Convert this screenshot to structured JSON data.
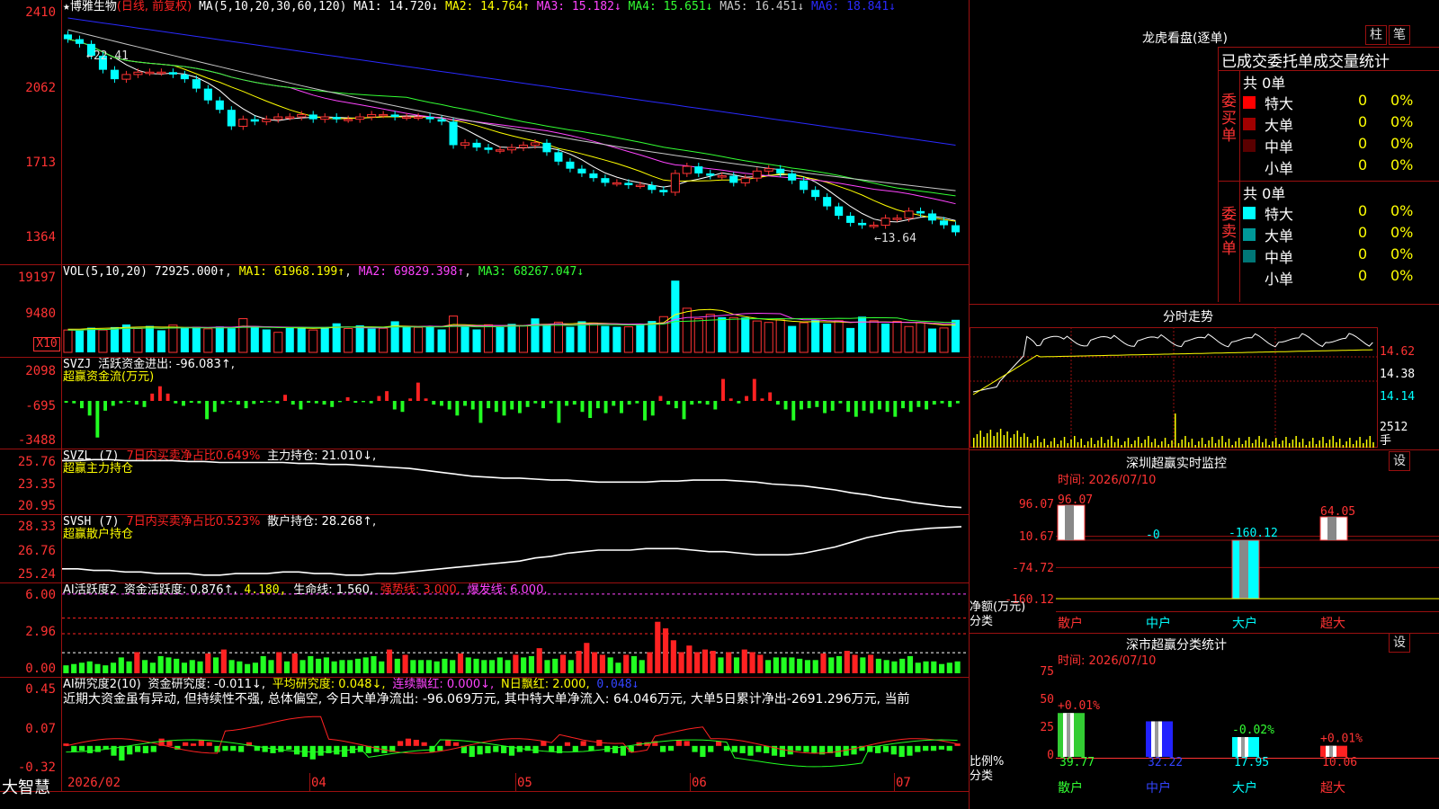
{
  "main": {
    "title": "博雅生物",
    "mode": "(日线, 前复权)",
    "ma_label": "MA(5,10,20,30,60,120)",
    "ma": [
      {
        "k": "MA1:",
        "v": "14.720↓",
        "c": "#ffffff"
      },
      {
        "k": "MA2:",
        "v": "14.764↑",
        "c": "#ffff00"
      },
      {
        "k": "MA3:",
        "v": "15.182↓",
        "c": "#ff44ff"
      },
      {
        "k": "MA4:",
        "v": "15.651↓",
        "c": "#33ff33"
      },
      {
        "k": "MA5:",
        "v": "16.451↓",
        "c": "#c8c8c8"
      },
      {
        "k": "MA6:",
        "v": "18.841↓",
        "c": "#2a2aff"
      }
    ],
    "y_ticks": [
      "2410",
      "2062",
      "1713",
      "1364"
    ],
    "high_label": "←22.41",
    "low_label": "←13.64"
  },
  "vol": {
    "label": "VOL(5,10,20)",
    "value": "72925.000↑",
    "ma1": "MA1: 61968.199↑",
    "ma2": "MA2: 69829.398↑",
    "ma3": "MA3: 68267.047↓",
    "y_ticks": [
      "19197",
      "9480"
    ],
    "unit": "X10"
  },
  "svzj": {
    "label": "SVZJ",
    "text": "活跃资金进出: -96.083↑,",
    "sub": "超赢资金流(万元)",
    "y_ticks": [
      "2098",
      "-695",
      "-3488"
    ]
  },
  "svzl": {
    "label": "SVZL (7)",
    "red": "7日内买卖净占比0.649%",
    "text": "主力持仓: 21.010↓,",
    "sub": "超赢主力持仓",
    "y_ticks": [
      "25.76",
      "23.35",
      "20.95"
    ]
  },
  "svsh": {
    "label": "SVSH (7)",
    "red": "7日内买卖净占比0.523%",
    "text": "散户持仓: 28.268↑,",
    "sub": "超赢散户持仓",
    "y_ticks": [
      "28.33",
      "26.76",
      "25.24"
    ]
  },
  "ai1": {
    "label": "AI活跃度2",
    "a": "资金活跃度: 0.876↑,",
    "b": "4.180,",
    "c": "生命线: 1.560,",
    "d": "强势线: 3.000,",
    "e": "爆发线: 6.000,",
    "y_ticks": [
      "6.00",
      "2.96",
      "0.00"
    ]
  },
  "ai2": {
    "label": "AI研究度2(10)",
    "a": "资金研究度: -0.011↓,",
    "b": "平均研究度: 0.048↓,",
    "c": "连续飘红: 0.000↓,",
    "d": "N日飘红: 2.000,",
    "e": "0.048↓",
    "comment": "近期大资金虽有异动, 但持续性不强, 总体偏空, 今日大单净流出: -96.069万元, 其中特大单净流入: 64.046万元, 大单5日累计净出-2691.296万元, 当前",
    "y_ticks": [
      "0.45",
      "0.07",
      "-0.32"
    ]
  },
  "xaxis": {
    "brand": "大智慧",
    "labels": [
      "2026/02",
      "04",
      "05",
      "06",
      "07"
    ]
  },
  "right": {
    "lhb_title": "龙虎看盘(逐单)",
    "btn_bar": "柱",
    "btn_line": "笔",
    "table_title": "已成交委托单成交量统计",
    "buy": {
      "side": "委买单",
      "total": "共 0单",
      "rows": [
        {
          "name": "特大",
          "n": "0",
          "p": "0%",
          "c": "#ff0000"
        },
        {
          "name": "大单",
          "n": "0",
          "p": "0%",
          "c": "#a00000"
        },
        {
          "name": "中单",
          "n": "0",
          "p": "0%",
          "c": "#5a0000"
        },
        {
          "name": "小单",
          "n": "0",
          "p": "0%",
          "c": "#000000"
        }
      ]
    },
    "sell": {
      "side": "委卖单",
      "total": "共 0单",
      "rows": [
        {
          "name": "特大",
          "n": "0",
          "p": "0%",
          "c": "#00ffff"
        },
        {
          "name": "大单",
          "n": "0",
          "p": "0%",
          "c": "#009999"
        },
        {
          "name": "中单",
          "n": "0",
          "p": "0%",
          "c": "#007777"
        },
        {
          "name": "小单",
          "n": "0",
          "p": "0%",
          "c": "#000000"
        }
      ]
    },
    "fs_title": "分时走势",
    "fs_prices": [
      "14.62",
      "14.38",
      "14.14"
    ],
    "fs_vol": "2512",
    "fs_unit": "手",
    "monitor_title": "深圳超赢实时监控",
    "monitor_time": "时间: 2026/07/10",
    "monitor_y": [
      "96.07",
      "10.67",
      "-74.72",
      "-160.12"
    ],
    "monitor_unit1": "净额(万元)",
    "monitor_unit2": "分类",
    "stat_title": "深市超赢分类统计",
    "stat_time": "时间: 2026/07/10",
    "stat_y": [
      "75",
      "50",
      "25",
      "0"
    ],
    "stat_unit1": "比例%",
    "stat_unit2": "分类",
    "set": "设",
    "categories": [
      "散户",
      "中户",
      "大户",
      "超大"
    ]
  },
  "chart_data": [
    {
      "type": "candlestick",
      "title": "博雅生物 (日线, 前复权)",
      "ylim": [
        13.2,
        23.2
      ],
      "y_ticks": [
        "2410",
        "2062",
        "1713",
        "1364"
      ],
      "close": [
        22.3,
        22.1,
        21.6,
        21.0,
        20.6,
        20.8,
        20.9,
        20.9,
        20.9,
        20.8,
        20.6,
        20.2,
        19.7,
        19.3,
        18.6,
        18.9,
        18.8,
        18.9,
        19.0,
        19.0,
        19.1,
        18.9,
        19.0,
        18.9,
        18.9,
        19.0,
        19.1,
        19.1,
        19.0,
        19.0,
        19.0,
        18.9,
        18.8,
        17.8,
        17.9,
        17.7,
        17.6,
        17.6,
        17.7,
        17.8,
        17.9,
        17.5,
        17.1,
        16.8,
        16.6,
        16.4,
        16.2,
        16.2,
        16.1,
        16.1,
        15.9,
        15.8,
        16.6,
        16.9,
        16.6,
        16.5,
        16.5,
        16.2,
        16.4,
        16.7,
        16.8,
        16.6,
        16.3,
        15.9,
        15.6,
        15.2,
        14.8,
        14.5,
        14.4,
        14.4,
        14.7,
        14.7,
        15.0,
        14.9,
        14.6,
        14.4,
        14.1
      ]
    },
    {
      "type": "bar",
      "title": "VOL(5,10,20)",
      "values": [
        7.7,
        7.5,
        8.5,
        7.7,
        8.7,
        9.6,
        8.2,
        9.1,
        7.6,
        9.4,
        8.7,
        8.8,
        8.1,
        8.9,
        8.3,
        11.6,
        9.0,
        7.9,
        6.9,
        8.6,
        8.6,
        7.7,
        8.7,
        10.0,
        8.2,
        9.3,
        8.2,
        8.3,
        10.7,
        8.9,
        8.6,
        9.1,
        7.9,
        12.5,
        8.8,
        7.9,
        9.5,
        8.7,
        9.8,
        9.1,
        11.7,
        9.7,
        10.4,
        8.8,
        10.7,
        10.1,
        9.1,
        8.8,
        8.8,
        9.6,
        10.8,
        12.3,
        24.7,
        15.2,
        11.6,
        13.1,
        12.1,
        12.0,
        12.0,
        10.8,
        10.3,
        11.2,
        9.1,
        10.2,
        11.2,
        9.9,
        10.9,
        8.4,
        12.3,
        10.9,
        9.9,
        10.7,
        8.9,
        10.2,
        8.2,
        8.4,
        11.2
      ],
      "ma1": [
        8,
        8,
        8.2,
        8.3,
        8.4,
        8.6,
        8.7,
        8.8,
        8.7,
        8.7,
        8.6,
        8.6,
        8.5,
        8.6,
        8.5,
        9,
        8.9,
        8.8,
        8.6,
        8.5,
        8.4,
        8.3,
        8.4,
        8.6,
        8.7,
        8.8,
        8.8,
        8.7,
        9.1,
        9,
        8.9,
        9,
        8.9,
        9.6,
        9.5,
        9.3,
        9.3,
        9.2,
        9.3,
        9.2,
        9.6,
        9.7,
        9.8,
        9.8,
        10.1,
        10.1,
        10,
        9.8,
        9.6,
        9.7,
        9.9,
        10.2,
        13,
        14,
        14.6,
        14.8,
        14.4,
        13.1,
        12.3,
        11.7,
        11.3,
        11.1,
        10.7,
        10.5,
        10.6,
        10.5,
        10.5,
        10.3,
        10.5,
        10.5,
        10.5,
        10.4,
        10.3,
        10.2,
        9.8,
        9.4,
        9.4
      ]
    },
    {
      "type": "bar",
      "title": "SVZJ",
      "values": [
        -150,
        -200,
        -600,
        -1200,
        -3000,
        -800,
        -400,
        -200,
        -100,
        -300,
        -500,
        600,
        1200,
        600,
        -200,
        -400,
        -150,
        -200,
        -1500,
        -900,
        -250,
        -100,
        -300,
        -600,
        -250,
        -150,
        -100,
        -200,
        500,
        -300,
        -700,
        -150,
        -200,
        -300,
        -500,
        -100,
        300,
        -150,
        -100,
        -200,
        400,
        800,
        -700,
        -900,
        200,
        1500,
        200,
        -300,
        -400,
        -700,
        -1200,
        -400,
        -700,
        -1800,
        -600,
        -900,
        -1200,
        -700,
        -1000,
        -500,
        -200,
        -600,
        -200,
        -1800,
        -400,
        -300,
        -900,
        -1400,
        -600,
        -1000,
        -400,
        -1000,
        -300,
        -200,
        -1600,
        -1200,
        400,
        -300,
        -600,
        -1500,
        -300,
        -200,
        -300,
        -700,
        1800,
        200,
        -200,
        400,
        1800,
        200,
        700,
        -300,
        -700,
        -1600,
        -700,
        -600,
        -500,
        -1000,
        -800,
        -200,
        -900,
        -1300,
        -800,
        -1000,
        -700,
        -900,
        -1300,
        -600,
        -900,
        -500,
        -700,
        -300,
        -200,
        -500,
        -200
      ]
    },
    {
      "type": "line",
      "title": "SVZL (7)",
      "ylim": [
        20.5,
        26.2
      ],
      "values": [
        25.8,
        25.8,
        25.9,
        25.9,
        25.8,
        25.8,
        25.8,
        25.8,
        25.7,
        25.7,
        25.6,
        25.6,
        25.6,
        25.6,
        25.6,
        25.5,
        25.5,
        25.4,
        25.4,
        25.3,
        25.2,
        25.1,
        25.0,
        24.8,
        24.6,
        24.4,
        24.2,
        24.1,
        24.0,
        24.0,
        23.9,
        23.8,
        23.8,
        23.7,
        23.6,
        23.6,
        23.6,
        23.6,
        23.7,
        23.7,
        23.8,
        23.8,
        23.8,
        23.7,
        23.6,
        23.4,
        23.3,
        23.2,
        23.0,
        22.8,
        22.5,
        22.3,
        22.0,
        21.8,
        21.5,
        21.3,
        21.1,
        21.0
      ]
    },
    {
      "type": "line",
      "title": "SVSH (7)",
      "ylim": [
        24.9,
        28.7
      ],
      "values": [
        25.6,
        25.6,
        25.5,
        25.5,
        25.4,
        25.4,
        25.3,
        25.3,
        25.3,
        25.2,
        25.2,
        25.3,
        25.3,
        25.3,
        25.4,
        25.4,
        25.3,
        25.3,
        25.2,
        25.2,
        25.3,
        25.3,
        25.4,
        25.5,
        25.6,
        25.7,
        25.8,
        25.9,
        26.0,
        26.1,
        26.3,
        26.4,
        26.6,
        26.7,
        26.8,
        26.8,
        26.8,
        26.9,
        26.9,
        26.9,
        26.8,
        26.7,
        26.7,
        26.6,
        26.5,
        26.5,
        26.5,
        26.6,
        26.8,
        27.0,
        27.3,
        27.6,
        27.8,
        28.0,
        28.1,
        28.2,
        28.25,
        28.3
      ]
    },
    {
      "type": "bar",
      "title": "AI活跃度2",
      "ylim": [
        0,
        6.4
      ],
      "lines": {
        "爆发线": 6.0,
        "强势线": 3.0,
        "生命线": 1.56
      },
      "values": [
        0.6,
        0.7,
        0.8,
        0.9,
        0.7,
        0.6,
        0.8,
        1.2,
        0.9,
        1.6,
        1.0,
        0.8,
        1.3,
        1.2,
        1.1,
        0.8,
        1.0,
        0.9,
        1.5,
        1.2,
        1.8,
        1.0,
        0.9,
        0.7,
        0.8,
        1.3,
        1.0,
        1.6,
        0.9,
        1.5,
        1.0,
        1.3,
        1.1,
        1.2,
        0.9,
        1.0,
        1.0,
        1.1,
        1.2,
        1.3,
        0.9,
        1.8,
        1.1,
        1.4,
        1.0,
        1.0,
        1.0,
        0.9,
        1.1,
        1.0,
        1.5,
        1.2,
        1.1,
        1.0,
        1.0,
        1.2,
        1.0,
        1.4,
        1.2,
        1.3,
        1.9,
        1.0,
        1.1,
        1.4,
        1.0,
        1.7,
        2.3,
        1.6,
        1.4,
        1.2,
        0.8,
        1.4,
        1.3,
        1.0,
        1.6,
        3.9,
        3.4,
        2.5,
        1.6,
        2.1,
        1.6,
        1.8,
        1.7,
        1.2,
        1.6,
        1.2,
        1.8,
        1.6,
        1.4,
        1.0,
        1.2,
        1.2,
        1.2,
        1.1,
        1.0,
        1.0,
        1.5,
        1.2,
        1.3,
        1.7,
        1.4,
        1.2,
        1.4,
        1.1,
        1.0,
        0.9,
        1.1,
        1.3,
        0.8,
        0.9,
        0.9,
        0.7,
        0.8,
        0.9
      ]
    },
    {
      "type": "bar",
      "title": "AI研究度2(10)",
      "ylim": [
        -0.34,
        0.47
      ],
      "values": [
        0.02,
        -0.05,
        -0.04,
        -0.06,
        -0.05,
        -0.03,
        -0.08,
        -0.12,
        -0.07,
        -0.05,
        -0.06,
        -0.05,
        0.06,
        0.04,
        -0.03,
        0.03,
        0.02,
        0.05,
        0.03,
        -0.05,
        -0.04,
        -0.04,
        -0.05,
        0.03,
        -0.04,
        -0.05,
        -0.06,
        -0.05,
        -0.03,
        -0.07,
        -0.09,
        -0.11,
        -0.08,
        -0.06,
        -0.07,
        -0.09,
        -0.06,
        -0.05,
        -0.06,
        -0.05,
        -0.06,
        -0.05,
        0.04,
        0.06,
        0.05,
        0.03,
        -0.05,
        -0.04,
        0.05,
        0.03,
        -0.06,
        -0.09,
        -0.07,
        -0.06,
        -0.05,
        -0.06,
        -0.08,
        -0.05,
        -0.04,
        -0.06,
        0.04,
        -0.05,
        -0.06,
        0.03,
        -0.05,
        0.04,
        -0.04,
        0.05,
        -0.05,
        -0.06,
        -0.08,
        -0.05,
        0.03,
        0.03,
        0.04,
        -0.05,
        -0.04,
        0.05,
        0.04,
        -0.05,
        -0.09,
        -0.05,
        0.04,
        -0.04,
        -0.05,
        -0.06,
        -0.08,
        -0.05,
        -0.06,
        -0.08,
        -0.09,
        -0.07,
        -0.04,
        -0.05,
        -0.06,
        -0.07,
        -0.06,
        -0.09,
        -0.08,
        -0.07,
        -0.04,
        -0.05,
        -0.06,
        -0.05,
        -0.07,
        -0.09,
        -0.08,
        -0.05,
        -0.04,
        -0.04,
        -0.03,
        -0.04,
        0.02
      ]
    },
    {
      "type": "bar",
      "title": "深圳超赢实时监控",
      "categories": [
        "散户",
        "中户",
        "大户",
        "超大"
      ],
      "values": [
        96.07,
        0,
        -160.12,
        64.05
      ],
      "ylim": [
        -160.12,
        96.07
      ]
    },
    {
      "type": "bar",
      "title": "深市超赢分类统计",
      "categories": [
        "散户",
        "中户",
        "大户",
        "超大"
      ],
      "values": [
        39.77,
        32.22,
        17.95,
        10.06
      ],
      "deltas": [
        "+0.01%",
        "",
        "-0.02%",
        "+0.01%"
      ],
      "ylim": [
        0,
        75
      ]
    }
  ]
}
